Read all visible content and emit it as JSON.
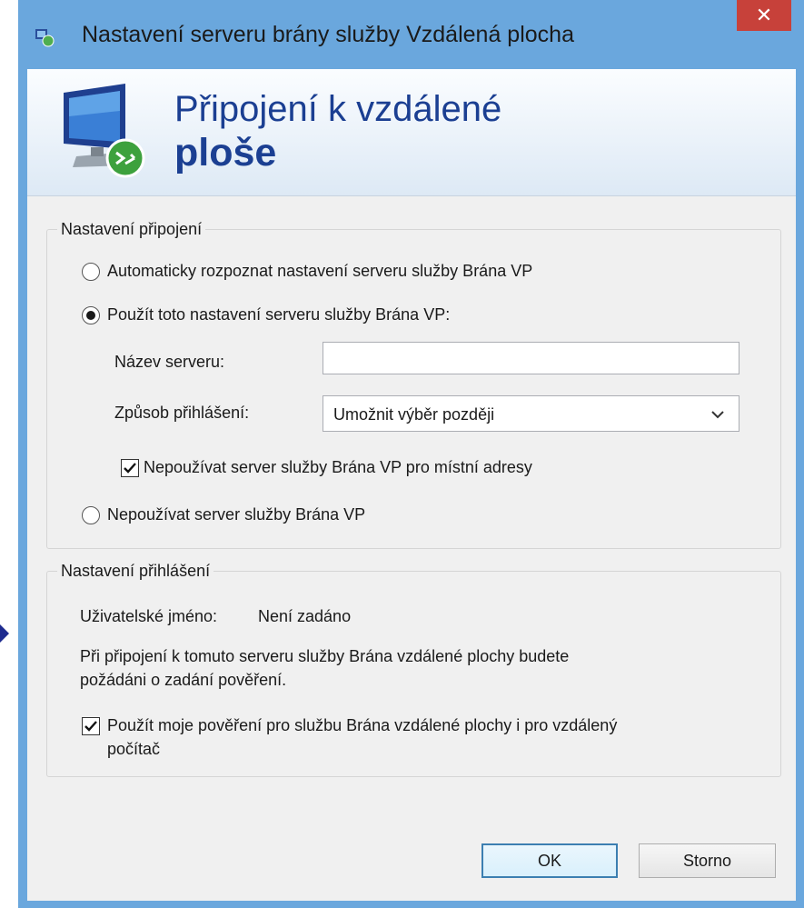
{
  "window": {
    "title": "Nastavení serveru brány služby Vzdálená plocha",
    "close_glyph": "✕"
  },
  "banner": {
    "line1": "Připojení k vzdálené",
    "line2": "ploše",
    "icon": "remote-desktop-monitor-icon"
  },
  "connection": {
    "legend": "Nastavení připojení",
    "auto_detect_label": "Automaticky rozpoznat nastavení serveru služby Brána VP",
    "auto_detect_selected": false,
    "use_settings_label": "Použít toto nastavení serveru služby Brána VP:",
    "use_settings_selected": true,
    "server_name_label": "Název serveru:",
    "server_name_value": "",
    "logon_method_label": "Způsob přihlášení:",
    "logon_method_value": "Umožnit výběr později",
    "bypass_local_label": "Nepoužívat server služby Brána VP pro místní adresy",
    "bypass_local_checked": true,
    "no_gateway_label": "Nepoužívat server služby Brána VP",
    "no_gateway_selected": false
  },
  "logon": {
    "legend": "Nastavení přihlášení",
    "username_label": "Uživatelské jméno:",
    "username_value": "Není zadáno",
    "info_line1": "Při připojení k tomuto serveru služby Brána vzdálené plochy budete",
    "info_line2": "požádáni o zadání pověření.",
    "use_credentials_line1": "Použít moje pověření pro službu Brána vzdálené plochy i pro vzdálený",
    "use_credentials_line2": "počítač",
    "use_credentials_checked": true
  },
  "buttons": {
    "ok_label": "OK",
    "cancel_label": "Storno"
  },
  "colors": {
    "frame": "#6aa7dd",
    "close": "#c7413a",
    "banner_text": "#1b3f92",
    "dialog_bg": "#f0f0f0"
  }
}
